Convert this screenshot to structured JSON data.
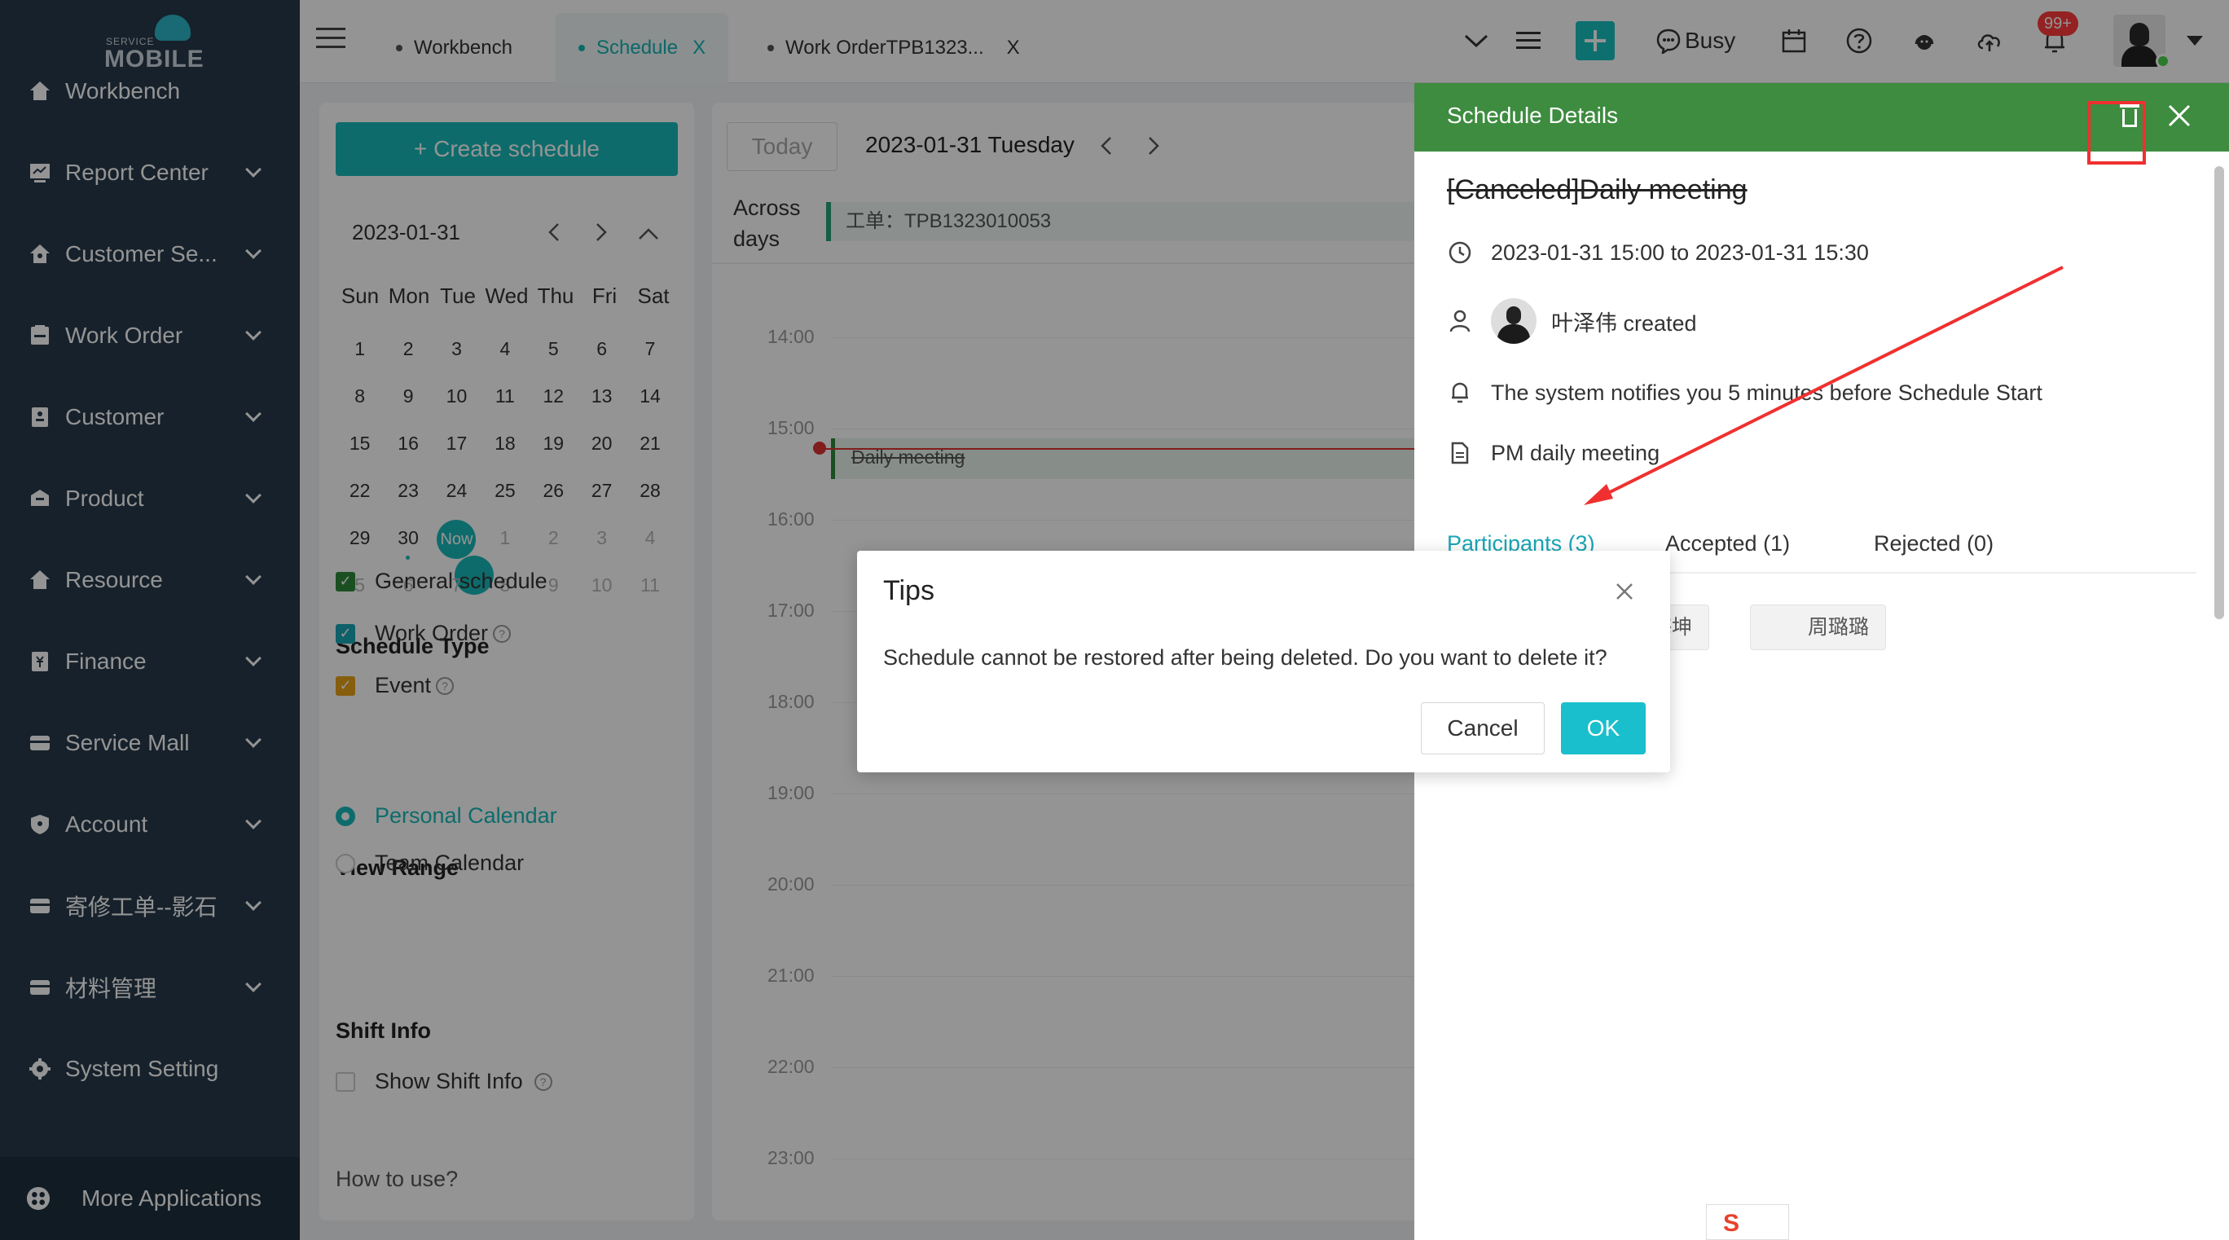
{
  "app": {
    "logo_top": "SERVICE",
    "logo_main": "MOBILE"
  },
  "sidebar": {
    "items": [
      {
        "label": "Workbench",
        "icon": "home-icon",
        "expandable": false
      },
      {
        "label": "Report Center",
        "icon": "report-icon",
        "expandable": true
      },
      {
        "label": "Customer Se...",
        "icon": "customer-service-icon",
        "expandable": true
      },
      {
        "label": "Work Order",
        "icon": "work-order-icon",
        "expandable": true
      },
      {
        "label": "Customer",
        "icon": "customer-icon",
        "expandable": true
      },
      {
        "label": "Product",
        "icon": "product-icon",
        "expandable": true
      },
      {
        "label": "Resource",
        "icon": "resource-icon",
        "expandable": true
      },
      {
        "label": "Finance",
        "icon": "finance-icon",
        "expandable": true
      },
      {
        "label": "Service Mall",
        "icon": "mall-icon",
        "expandable": true
      },
      {
        "label": "Account",
        "icon": "account-icon",
        "expandable": true
      },
      {
        "label": "寄修工单--影石",
        "icon": "repair-icon",
        "expandable": true
      },
      {
        "label": "材料管理",
        "icon": "material-icon",
        "expandable": true
      },
      {
        "label": "System Setting",
        "icon": "settings-icon",
        "expandable": false
      }
    ],
    "more_applications": "More Applications"
  },
  "topbar": {
    "tabs": [
      {
        "label": "Workbench",
        "active": false,
        "closable": false
      },
      {
        "label": "Schedule",
        "active": true,
        "closable": true
      },
      {
        "label": "Work OrderTPB1323...",
        "active": false,
        "closable": true
      }
    ],
    "tab_close_symbol": "X",
    "status": "Busy",
    "notification_count": "99+"
  },
  "left_panel": {
    "create_button": "+ Create schedule",
    "month_label": "2023-01-31",
    "weekdays": [
      "Sun",
      "Mon",
      "Tue",
      "Wed",
      "Thu",
      "Fri",
      "Sat"
    ],
    "weeks": [
      [
        "1",
        "2",
        "3",
        "4",
        "5",
        "6",
        "7"
      ],
      [
        "8",
        "9",
        "10",
        "11",
        "12",
        "13",
        "14"
      ],
      [
        "15",
        "16",
        "17",
        "18",
        "19",
        "20",
        "21"
      ],
      [
        "22",
        "23",
        "24",
        "25",
        "26",
        "27",
        "28"
      ],
      [
        "29",
        "30",
        "Now",
        "1",
        "2",
        "3",
        "4"
      ],
      [
        "5",
        "6",
        "7",
        "8",
        "9",
        "10",
        "11"
      ]
    ],
    "schedule_type_title": "Schedule Type",
    "schedule_types": [
      {
        "label": "General schedule",
        "checked": true,
        "color": "#2e8b3a",
        "help": false
      },
      {
        "label": "Work Order",
        "checked": true,
        "color": "#19a5b5",
        "help": true
      },
      {
        "label": "Event",
        "checked": true,
        "color": "#e8a317",
        "help": true
      }
    ],
    "view_range_title": "View Range",
    "view_ranges": [
      {
        "label": "Personal Calendar",
        "selected": true
      },
      {
        "label": "Team Calendar",
        "selected": false
      }
    ],
    "shift_info_title": "Shift Info",
    "show_shift_info": "Show Shift Info",
    "how_to_use": "How to use?"
  },
  "main": {
    "today_button": "Today",
    "current_date": "2023-01-31 Tuesday",
    "across_days": "Across days",
    "across_days_event": "工单：TPB1323010053",
    "hours": [
      "14:00",
      "15:00",
      "16:00",
      "17:00",
      "18:00",
      "19:00",
      "20:00",
      "21:00",
      "22:00",
      "23:00"
    ],
    "event_label": "Daily meeting"
  },
  "drawer": {
    "title": "Schedule Details",
    "event_title": "[Canceled]Daily meeting",
    "time_range": "2023-01-31 15:00 to 2023-01-31 15:30",
    "creator": "叶泽伟 created",
    "reminder": "The system notifies you 5 minutes before Schedule Start",
    "description": "PM daily meeting",
    "tabs": [
      {
        "label": "Participants (3)",
        "active": true
      },
      {
        "label": "Accepted (1)",
        "active": false
      },
      {
        "label": "Rejected (0)",
        "active": false
      }
    ],
    "participants": [
      "海坤",
      "周璐璐"
    ]
  },
  "modal": {
    "title": "Tips",
    "message": "Schedule cannot be restored after being deleted. Do you want to delete it?",
    "cancel": "Cancel",
    "ok": "OK"
  },
  "colors": {
    "sidebar_bg": "#273a4a",
    "accent": "#19b8b8",
    "drawer_header": "#3d8c3f",
    "annotation": "#f03030"
  }
}
